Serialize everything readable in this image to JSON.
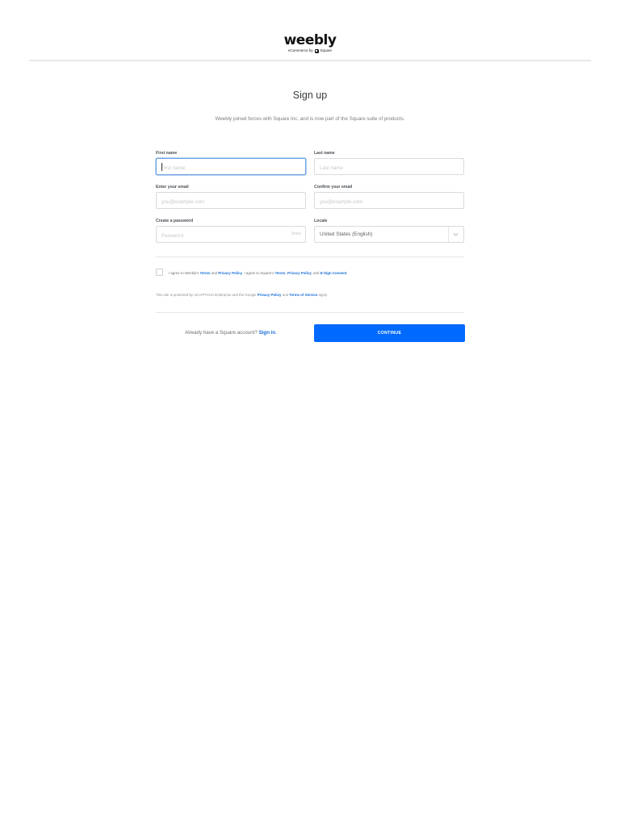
{
  "brand": {
    "logo_text": "weebly",
    "sub_prefix": "eCommerce by",
    "sub_brand": "Square"
  },
  "page": {
    "title": "Sign up",
    "intro": "Weebly joined forces with Square Inc. and is now part of the Square suite of products."
  },
  "form": {
    "first_name": {
      "label": "First name",
      "placeholder": "First name",
      "value": ""
    },
    "last_name": {
      "label": "Last name",
      "placeholder": "Last name",
      "value": ""
    },
    "email": {
      "label": "Enter your email",
      "placeholder": "you@example.com",
      "value": ""
    },
    "confirm_email": {
      "label": "Confirm your email",
      "placeholder": "you@example.com",
      "value": ""
    },
    "password": {
      "label": "Create a password",
      "placeholder": "Password",
      "value": "",
      "show_label": "Show"
    },
    "locale": {
      "label": "Locale",
      "selected": "United States (English)"
    }
  },
  "agreement": {
    "t1": "I agree to Weebly's ",
    "terms": "Terms",
    "t2": " and ",
    "privacy": "Privacy Policy",
    "t3": ". I agree to Square's ",
    "sq_terms": "Terms",
    "t4": ", ",
    "sq_privacy": "Privacy Policy",
    "t5": ", and ",
    "esign": "E-Sign Consent",
    "t6": ".",
    "checked": false
  },
  "recaptcha": {
    "t1": "This site is protected by reCAPTCHA Enterprise and the Google ",
    "privacy": "Privacy Policy",
    "t2": " and ",
    "terms": "Terms of Service",
    "t3": " apply."
  },
  "footer": {
    "signin_prompt": "Already have a Square account? ",
    "signin_link": "Sign in",
    "signin_end": ".",
    "continue_label": "CONTINUE"
  },
  "colors": {
    "primary": "#006aff",
    "link": "#1a6ed8",
    "focus": "#6fa2e6"
  }
}
